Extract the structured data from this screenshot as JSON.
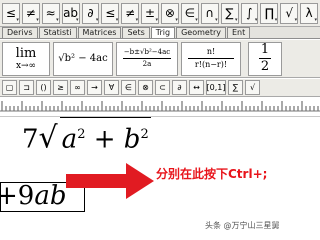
{
  "symbol_toolbar": {
    "buttons": [
      "≤",
      "≠",
      "≈",
      "ab",
      "∂",
      "≤",
      "≠",
      "±",
      "⊗",
      "∈",
      "∩",
      "∑",
      "∫",
      "∏",
      "√",
      "λ"
    ],
    "first_label": "≤"
  },
  "tabs": [
    "Derivs",
    "Statisti",
    "Matrices",
    "Sets",
    "Trig",
    "Geometry",
    "Ent"
  ],
  "templates": {
    "lim_top": "lim",
    "lim_sub": "x→∞",
    "sqrt_label": "√b² − 4ac",
    "quad_num": "−b±√b²−4ac",
    "quad_den": "2a",
    "comb_num": "n!",
    "comb_den": "r!(n−r)!",
    "half_num": "1",
    "half_den": "2"
  },
  "small_toolbar": [
    "▢",
    "⊐",
    "()",
    "≥",
    "∞",
    "→",
    "∀",
    "∈",
    "⊗",
    "⊂",
    "∂",
    "↔",
    "[0,1]",
    "∑",
    "√"
  ],
  "canvas": {
    "expr1_coef": "7",
    "expr1_radicand_a": "a",
    "expr1_plus": " + ",
    "expr1_radicand_b": "b",
    "exp": "2",
    "expr2_plus": "+",
    "expr2_coef": "9",
    "expr2_var": "ab"
  },
  "annotation": "分别在此按下Ctrl+;",
  "watermark": "头条 @万宁山三星舅"
}
